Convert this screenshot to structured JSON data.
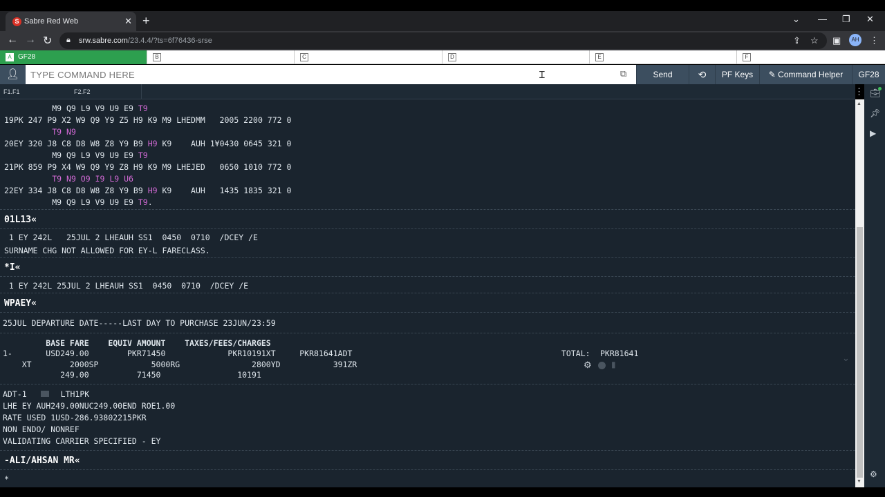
{
  "browser": {
    "tab_title": "Sabre Red Web",
    "favicon_letter": "S",
    "close_glyph": "✕",
    "new_tab_glyph": "+",
    "url_host": "srw.sabre.com",
    "url_path": "/23.4.4/?ts=6f76436-srse",
    "avatar_text": "AH"
  },
  "work_areas": [
    {
      "letter": "A",
      "label": "GF28",
      "active": true
    },
    {
      "letter": "B",
      "label": ""
    },
    {
      "letter": "C",
      "label": ""
    },
    {
      "letter": "D",
      "label": ""
    },
    {
      "letter": "E",
      "label": ""
    },
    {
      "letter": "F",
      "label": ""
    }
  ],
  "command_bar": {
    "placeholder": "TYPE COMMAND HERE",
    "send_label": "Send",
    "pf_keys_label": "PF Keys",
    "command_helper_label": "Command Helper",
    "pcc_label": "GF28"
  },
  "subheader": {
    "f1": "F1.F1",
    "f2": "F2.F2"
  },
  "terminal": {
    "avail_lines": [
      {
        "pre": "          M9 Q9 L9 V9 U9 E9 ",
        "purple": "T9",
        "post": ""
      },
      {
        "pre": "19PK 247 P9 X2 W9 Q9 Y9 Z5 H9 K9 M9 LHEDMM   2005 2200 772 0",
        "purple": "",
        "post": ""
      },
      {
        "pre": "          ",
        "purple": "T9 N9",
        "post": ""
      },
      {
        "pre": "20EY 320 J8 C8 D8 W8 Z8 Y9 B9 ",
        "purple": "H9",
        "post": " K9    AUH 1¥0430 0645 321 0"
      },
      {
        "pre": "          M9 Q9 L9 V9 U9 E9 ",
        "purple": "T9",
        "post": ""
      },
      {
        "pre": "21PK 859 P9 X4 W9 Q9 Y9 Z8 H9 K9 M9 LHEJED   0650 1010 772 0",
        "purple": "",
        "post": ""
      },
      {
        "pre": "          ",
        "purple": "T9 N9 O9 I9 L9 U6",
        "post": ""
      },
      {
        "pre": "22EY 334 J8 C8 D8 W8 Z8 Y9 B9 ",
        "purple": "H9",
        "post": " K9    AUH   1435 1835 321 0"
      },
      {
        "pre": "          M9 Q9 L9 V9 U9 E9 ",
        "purple": "T9",
        "post": "."
      }
    ],
    "cmd1": "01L13«",
    "sell_line": " 1 EY 242L   25JUL 2 LHEAUH SS1  0450  0710  /DCEY /E",
    "surname_msg": "SURNAME CHG NOT ALLOWED FOR EY-L FARECLASS.",
    "cmd2": "*I«",
    "itin_line": " 1 EY 242L 25JUL 2 LHEAUH SS1  0450  0710  /DCEY /E",
    "cmd3": "WPAEY«",
    "last_day": "25JUL DEPARTURE DATE-----LAST DAY TO PURCHASE 23JUN/23:59",
    "fare_header": "         BASE FARE    EQUIV AMOUNT    TAXES/FEES/CHARGES",
    "fare_row1": "1-       USD249.00        PKR71450             PKR10191XT     PKR81641ADT",
    "fare_row2": "    XT        2000SP           5000RG               2800YD           391ZR",
    "fare_row3": "            249.00          71450                10191",
    "total_label": "TOTAL:",
    "total_value": "PKR81641",
    "adt_left": "ADT-1",
    "adt_right": "LTH1PK",
    "calc_line": "LHE EY AUH249.00NUC249.00END ROE1.00",
    "rate_line": "RATE USED 1USD-286.93802215PKR",
    "endo_line": "NON ENDO/ NONREF",
    "validating_line": "VALIDATING CARRIER SPECIFIED - EY",
    "cmd4": "-ALI/AHSAN MR«",
    "prompt": "*"
  },
  "colors": {
    "terminal_bg": "#1a242e",
    "command_bar_bg": "#3c4e5f",
    "active_area": "#2d9f4f",
    "highlight": "#d56bd8"
  }
}
